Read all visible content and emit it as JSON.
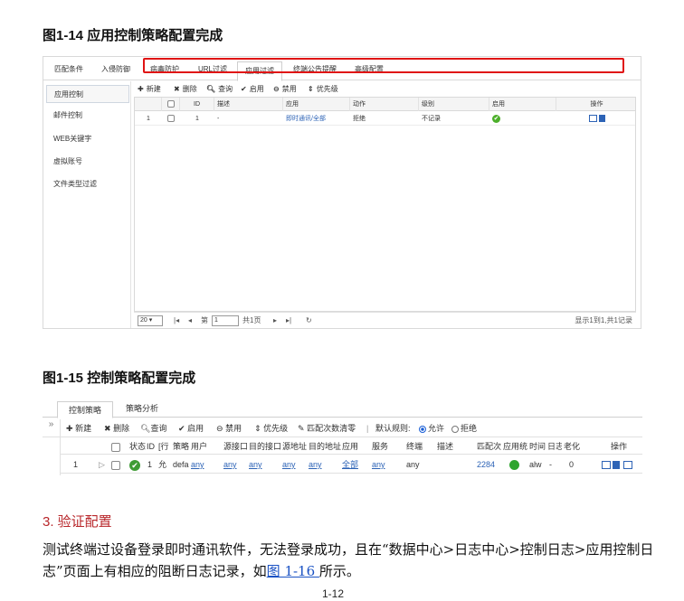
{
  "fig1": {
    "title": "图1-14  应用控制策略配置完成",
    "tabs": [
      "匹配条件",
      "入侵防御",
      "病毒防护",
      "URL过滤",
      "应用过滤",
      "终端公告提醒",
      "高级配置"
    ],
    "sidebar": [
      "应用控制",
      "邮件控制",
      "WEB关键字",
      "虚拟账号",
      "文件类型过滤"
    ],
    "toolbar": [
      "新建",
      "删除",
      "查询",
      "启用",
      "禁用",
      "优先级"
    ],
    "columns": [
      "ID",
      "描述",
      "应用",
      "动作",
      "级别",
      "启用",
      "操作"
    ],
    "row": {
      "num": "1",
      "id": "1",
      "desc": "-",
      "app": "即时通讯/全部",
      "action": "拒绝",
      "level": "不记录"
    },
    "pager": {
      "size": "20",
      "page_prefix": "第",
      "page_value": "1",
      "page_suffix": "共1页",
      "summary": "显示1到1,共1记录"
    }
  },
  "fig2": {
    "title": "图1-15  控制策略配置完成",
    "tabs": [
      "控制策略",
      "策略分析"
    ],
    "toolbar": [
      "新建",
      "删除",
      "查询",
      "启用",
      "禁用",
      "优先级",
      "匹配次数清零"
    ],
    "default_rule_label": "默认规则:",
    "allow": "允许",
    "deny": "拒绝",
    "columns": [
      "状态",
      "ID",
      "[行",
      "策略",
      "用户",
      "源接口",
      "目的接口",
      "源地址",
      "目的地址",
      "应用",
      "服务",
      "终端",
      "描述",
      "匹配次",
      "应用统",
      "时间",
      "日志",
      "老化",
      "操作"
    ],
    "row": {
      "num": "1",
      "id": "1",
      "rowtag": "允",
      "policy": "defa",
      "user": "any",
      "src_if": "any",
      "dst_if": "any",
      "src_addr": "any",
      "dst_addr": "any",
      "app": "全部",
      "service": "any",
      "terminal": "any",
      "desc": "",
      "match": "2284",
      "time": "alw",
      "log": "-",
      "aging": "0"
    }
  },
  "section": {
    "title": "3. 验证配置",
    "para_before": "测试终端过设备登录即时通讯软件，无法登录成功，且在“数据中心>日志中心>控制日志>应用控制日志”页面上有相应的阻断日志记录，如",
    "link": "图 1-16 ",
    "para_after": "所示。"
  },
  "page_number": "1-12"
}
